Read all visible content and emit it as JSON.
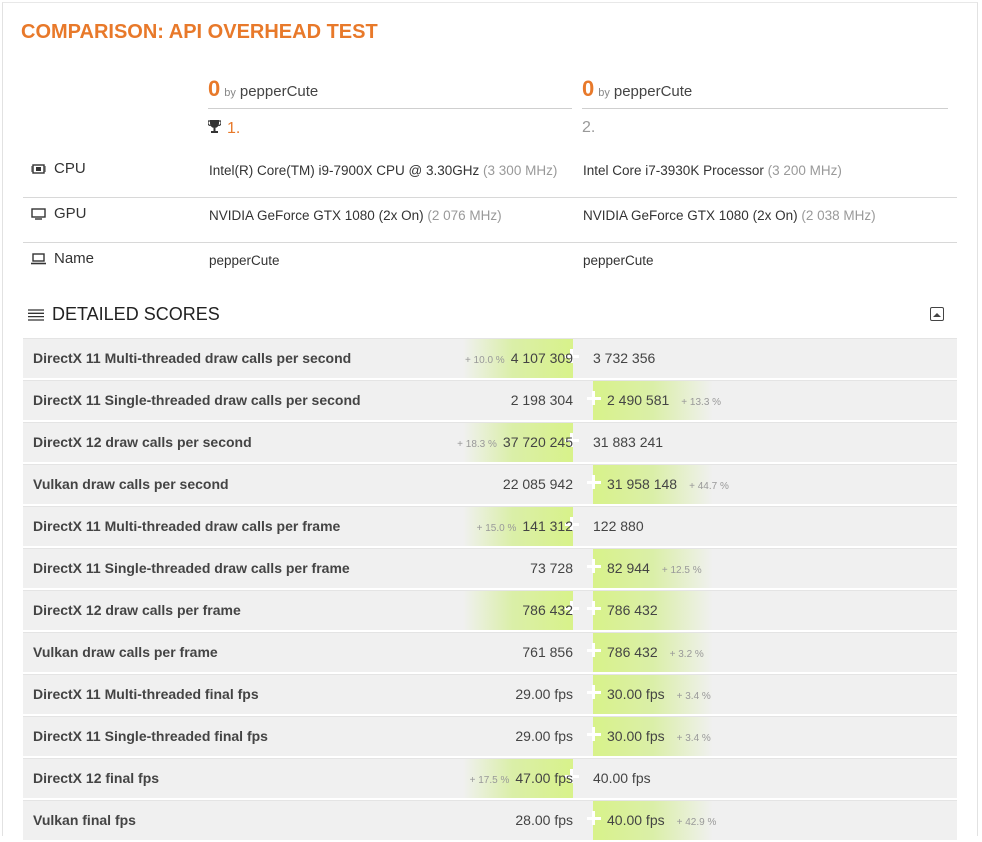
{
  "page_title": "COMPARISON: API OVERHEAD TEST",
  "results": [
    {
      "score": "0",
      "by": "by",
      "user": "pepperCute",
      "rank": "1.",
      "rank_trophy": true
    },
    {
      "score": "0",
      "by": "by",
      "user": "pepperCute",
      "rank": "2.",
      "rank_trophy": false
    }
  ],
  "info_rows": [
    {
      "label": "CPU",
      "icon": "cpu-icon",
      "left": {
        "value": "Intel(R) Core(TM) i9-7900X CPU @ 3.30GHz",
        "mhz": "(3 300 MHz)"
      },
      "right": {
        "value": "Intel Core i7-3930K Processor",
        "mhz": "(3 200 MHz)"
      }
    },
    {
      "label": "GPU",
      "icon": "monitor-icon",
      "left": {
        "value": "NVIDIA GeForce GTX 1080 (2x On)",
        "mhz": "(2 076 MHz)"
      },
      "right": {
        "value": "NVIDIA GeForce GTX 1080 (2x On)",
        "mhz": "(2 038 MHz)"
      }
    },
    {
      "label": "Name",
      "icon": "laptop-icon",
      "left": {
        "value": "pepperCute",
        "mhz": ""
      },
      "right": {
        "value": "pepperCute",
        "mhz": ""
      }
    }
  ],
  "detailed_scores_title": "DETAILED SCORES",
  "scores": [
    {
      "label": "DirectX 11 Multi-threaded draw calls per second",
      "left": "4 107 309",
      "right": "3 732 356",
      "winner": "left",
      "pct": "+ 10.0 %"
    },
    {
      "label": "DirectX 11 Single-threaded draw calls per second",
      "left": "2 198 304",
      "right": "2 490 581",
      "winner": "right",
      "pct": "+ 13.3 %"
    },
    {
      "label": "DirectX 12 draw calls per second",
      "left": "37 720 245",
      "right": "31 883 241",
      "winner": "left",
      "pct": "+ 18.3 %"
    },
    {
      "label": "Vulkan draw calls per second",
      "left": "22 085 942",
      "right": "31 958 148",
      "winner": "right",
      "pct": "+ 44.7 %"
    },
    {
      "label": "DirectX 11 Multi-threaded draw calls per frame",
      "left": "141 312",
      "right": "122 880",
      "winner": "left",
      "pct": "+ 15.0 %"
    },
    {
      "label": "DirectX 11 Single-threaded draw calls per frame",
      "left": "73 728",
      "right": "82 944",
      "winner": "right",
      "pct": "+ 12.5 %"
    },
    {
      "label": "DirectX 12 draw calls per frame",
      "left": "786 432",
      "right": "786 432",
      "winner": "both",
      "pct": ""
    },
    {
      "label": "Vulkan draw calls per frame",
      "left": "761 856",
      "right": "786 432",
      "winner": "right",
      "pct": "+ 3.2 %"
    },
    {
      "label": "DirectX 11 Multi-threaded final fps",
      "left": "29.00 fps",
      "right": "30.00 fps",
      "winner": "right",
      "pct": "+ 3.4 %"
    },
    {
      "label": "DirectX 11 Single-threaded final fps",
      "left": "29.00 fps",
      "right": "30.00 fps",
      "winner": "right",
      "pct": "+ 3.4 %"
    },
    {
      "label": "DirectX 12 final fps",
      "left": "47.00 fps",
      "right": "40.00 fps",
      "winner": "left",
      "pct": "+ 17.5 %"
    },
    {
      "label": "Vulkan final fps",
      "left": "28.00 fps",
      "right": "40.00 fps",
      "winner": "right",
      "pct": "+ 42.9 %"
    }
  ],
  "colors": {
    "accent": "#e8792a",
    "win_highlight": "#d8f28a",
    "row_bg": "#f0f0f0"
  }
}
